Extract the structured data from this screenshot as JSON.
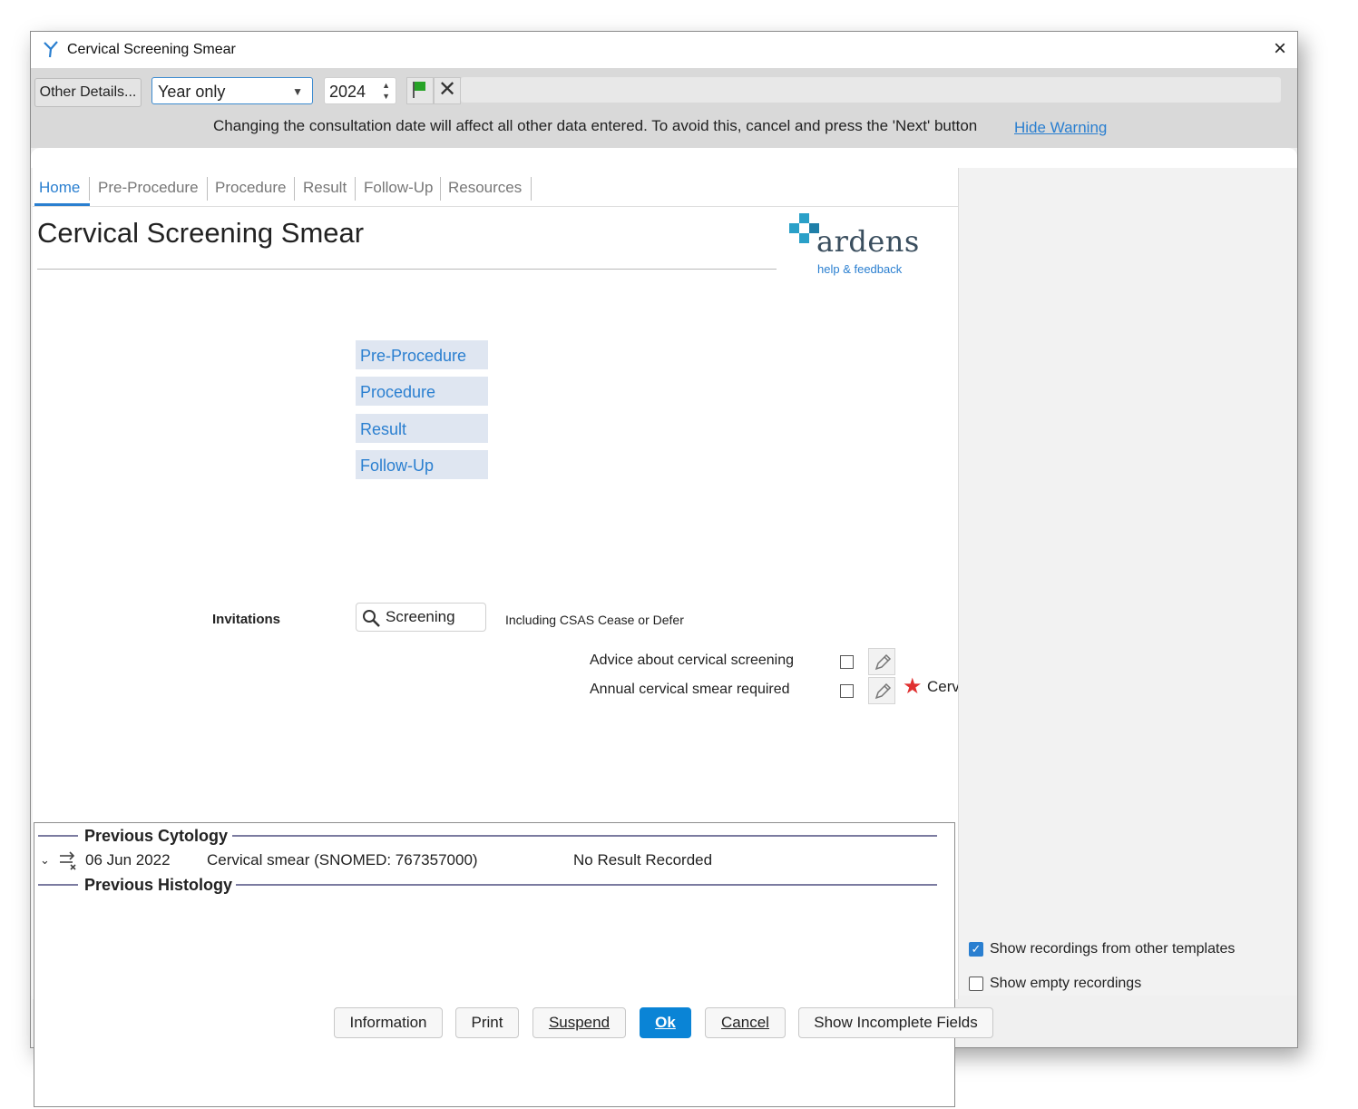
{
  "window": {
    "title": "Cervical Screening Smear",
    "close_icon": "×"
  },
  "toolbar": {
    "other_details_label": "Other Details...",
    "date_precision_value": "Year only",
    "year_value": "2024",
    "warning_text": "Changing the consultation date will affect all other data entered. To avoid this, cancel and press the 'Next' button",
    "hide_warning_label": "Hide Warning"
  },
  "tabs": [
    {
      "label": "Home"
    },
    {
      "label": "Pre-Procedure"
    },
    {
      "label": "Procedure"
    },
    {
      "label": "Result"
    },
    {
      "label": "Follow-Up"
    },
    {
      "label": "Resources"
    }
  ],
  "page": {
    "title": "Cervical Screening Smear",
    "logo_word": "ardens",
    "logo_sub": "help & feedback"
  },
  "nav_buttons": [
    {
      "label": "Pre-Procedure"
    },
    {
      "label": "Procedure"
    },
    {
      "label": "Result"
    },
    {
      "label": "Follow-Up"
    }
  ],
  "invitations": {
    "label": "Invitations",
    "search_label": "Screening",
    "note": "Including CSAS Cease or Defer"
  },
  "recordings": [
    {
      "label": "Advice about cervical screening",
      "checked": false
    },
    {
      "label": "Annual cervical smear required",
      "checked": false,
      "tag": "Cerv"
    }
  ],
  "history": {
    "cytology_heading": "Previous Cytology",
    "cytology_rows": [
      {
        "date": "06 Jun 2022",
        "description": "Cervical smear (SNOMED: 767357000)",
        "result": "No Result Recorded"
      }
    ],
    "histology_heading": "Previous Histology"
  },
  "options": [
    {
      "label": "Show recordings from other templates",
      "checked": true
    },
    {
      "label": "Show empty recordings",
      "checked": false
    }
  ],
  "footer": {
    "information": "Information",
    "print": "Print",
    "suspend": "Suspend",
    "ok": "Ok",
    "cancel": "Cancel",
    "show_incomplete": "Show Incomplete Fields"
  },
  "colors": {
    "accent": "#2a7fd0",
    "primary_button": "#0a84d6",
    "star": "#e03030",
    "flag": "#27a327"
  }
}
